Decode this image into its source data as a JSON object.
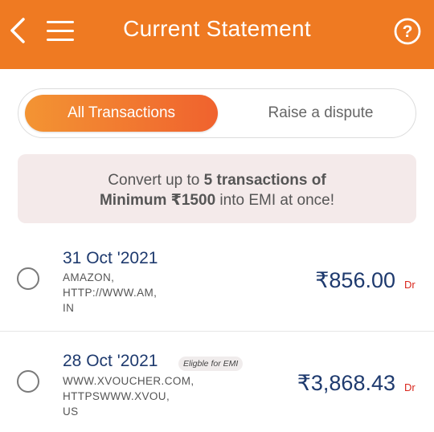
{
  "header": {
    "title": "Current Statement"
  },
  "tabs": [
    {
      "label": "All Transactions",
      "active": true
    },
    {
      "label": "Raise a dispute",
      "active": false
    }
  ],
  "banner": {
    "pre": "Convert up to ",
    "bold1": "5 transactions of",
    "bold2": "Minimum ₹1500",
    "post": " into EMI at once!"
  },
  "transactions": [
    {
      "date": "31 Oct '2021",
      "description_lines": [
        "AMAZON,",
        "HTTP://WWW.AM,",
        "IN"
      ],
      "amount": "₹856.00",
      "type": "Dr"
    },
    {
      "date": "28 Oct '2021",
      "badge": "Eligble for EMI",
      "description_lines": [
        "WWW.XVOUCHER.COM,",
        "HTTPSWWW.XVOU,",
        "US"
      ],
      "amount": "₹3,868.43",
      "type": "Dr"
    }
  ],
  "colors": {
    "header_bg": "#ef7a22",
    "active_tab_start": "#f39433",
    "active_tab_end": "#f0622e",
    "amount_text": "#1e3a6e",
    "debit_label": "#d9261c",
    "banner_bg": "#f4eaea"
  },
  "icons": {
    "back": "chevron-left-icon",
    "menu": "hamburger-menu-icon",
    "help": "help-circle-icon"
  }
}
